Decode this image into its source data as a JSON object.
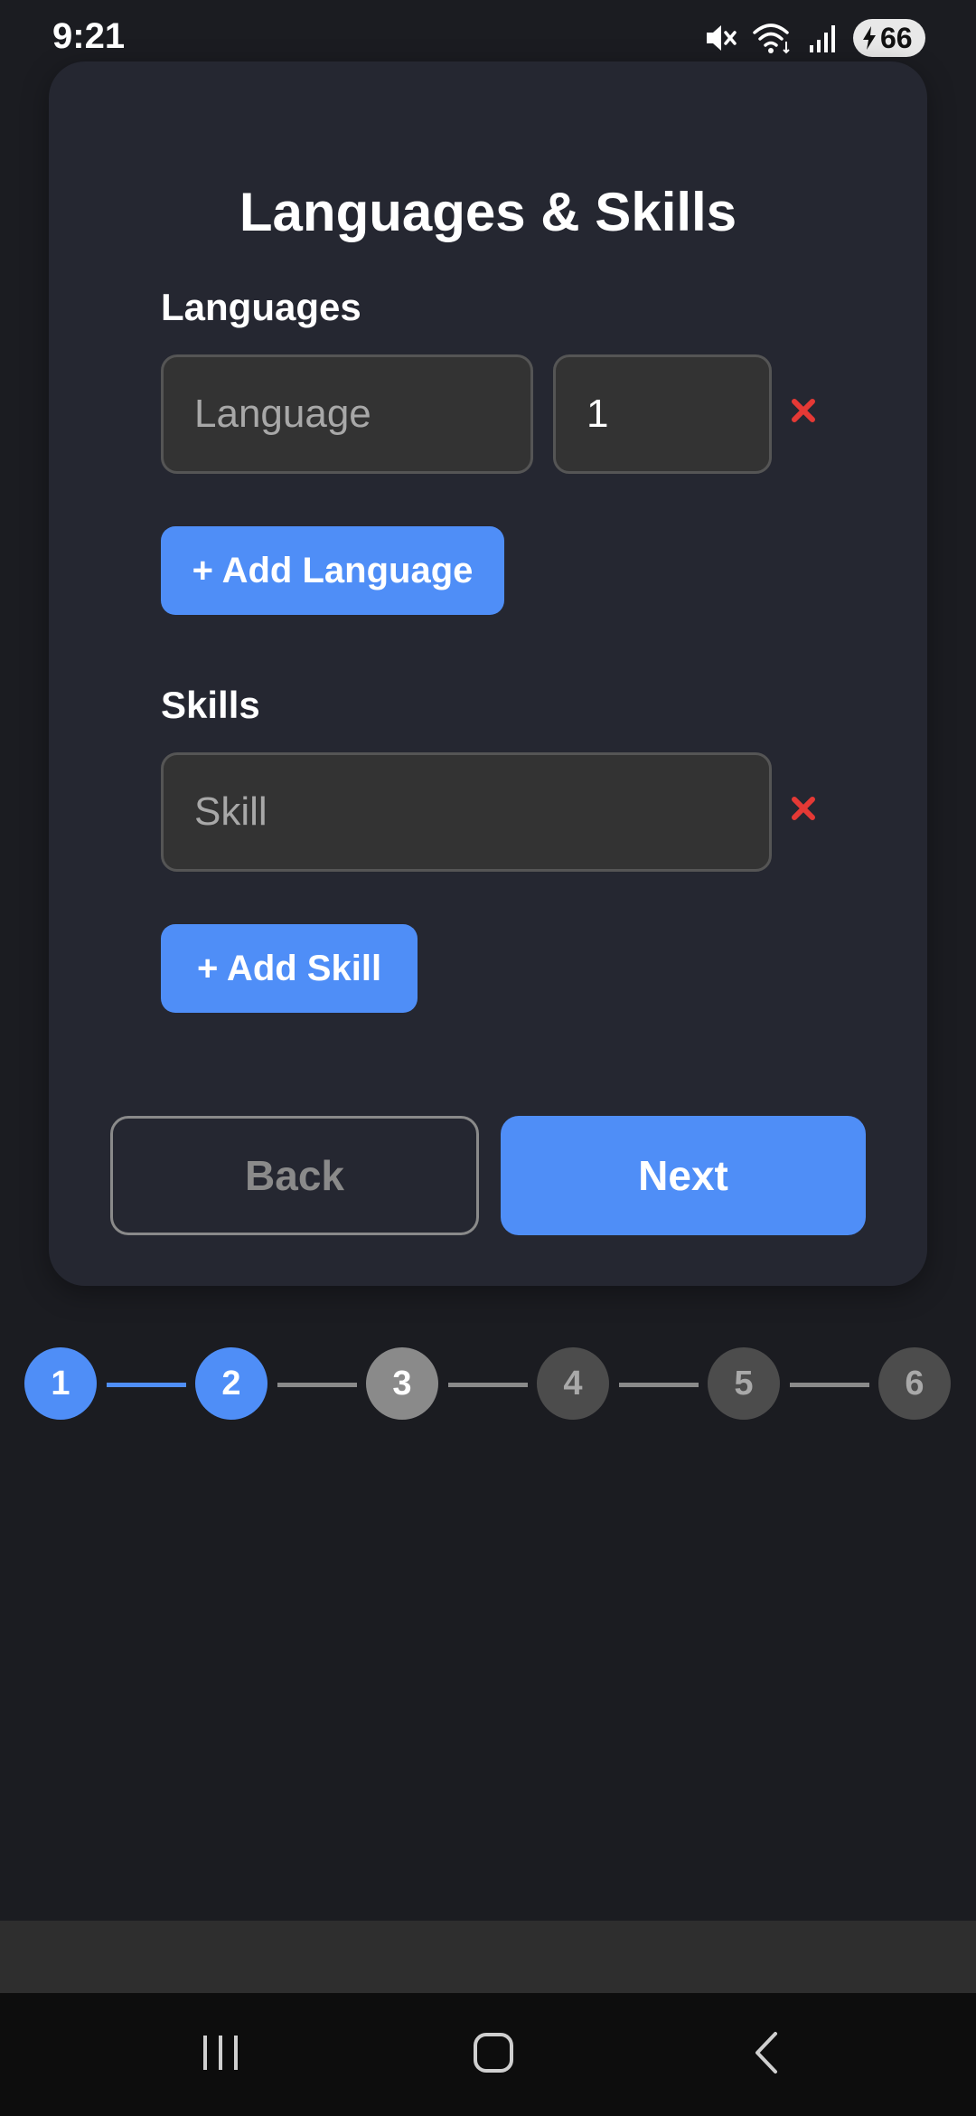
{
  "status_bar": {
    "time": "9:21",
    "battery": "66",
    "icons": [
      "mute-icon",
      "wifi-icon",
      "signal-icon",
      "battery-charging-icon"
    ]
  },
  "form": {
    "title": "Languages & Skills",
    "languages": {
      "label": "Languages",
      "entries": [
        {
          "language_value": "",
          "language_placeholder": "Language",
          "level_value": "1"
        }
      ],
      "add_label": "+ Add Language"
    },
    "skills": {
      "label": "Skills",
      "entries": [
        {
          "skill_value": "",
          "skill_placeholder": "Skill"
        }
      ],
      "add_label": "+ Add Skill"
    },
    "back_label": "Back",
    "next_label": "Next"
  },
  "stepper": {
    "current_step": 2,
    "steps": [
      "1",
      "2",
      "3",
      "4",
      "5",
      "6"
    ]
  },
  "colors": {
    "accent": "#4f8ef7",
    "remove": "#e53935",
    "background": "#1b1c21",
    "card": "#252731"
  },
  "nav_bar": {
    "icons": [
      "recent-apps-icon",
      "home-icon",
      "back-icon"
    ]
  }
}
